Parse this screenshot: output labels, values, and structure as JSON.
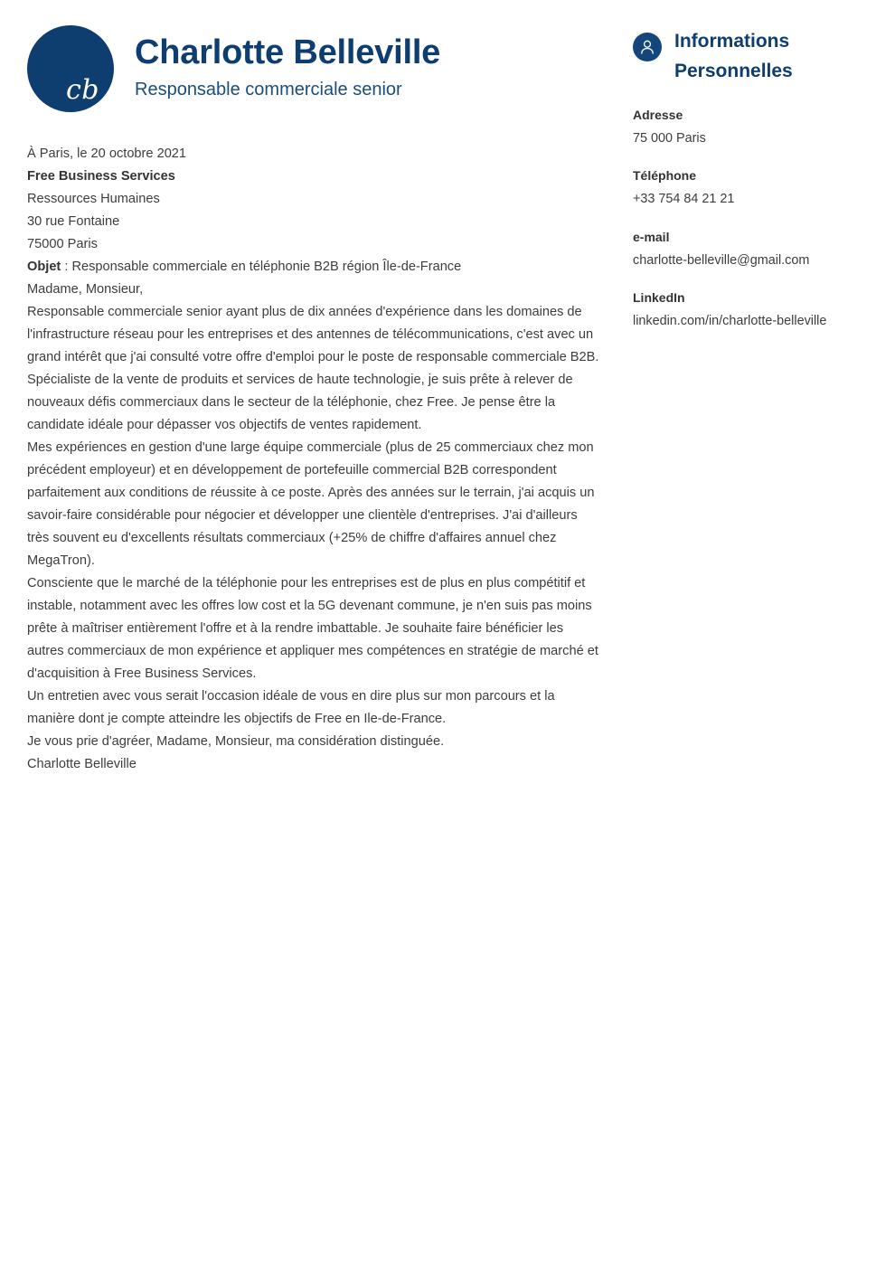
{
  "header": {
    "monogram": "cb",
    "monogram_icon": "monogram-initials",
    "full_name": "Charlotte Belleville",
    "job_title": "Responsable commerciale senior"
  },
  "letter": {
    "date_line": "À Paris, le 20 octobre 2021",
    "recipient": {
      "organization": "Free Business Services",
      "department": "Ressources Humaines",
      "street": "30 rue Fontaine",
      "city": "75000 Paris"
    },
    "subject": {
      "label": "Objet",
      "text": " : Responsable commerciale en téléphonie B2B région Île-de-France"
    },
    "salutation": "Madame, Monsieur,",
    "paragraphs": [
      "Responsable commerciale senior ayant plus de dix années d'expérience dans les domaines de l'infrastructure réseau pour les entreprises et des antennes de télécommunications, c'est avec un grand intérêt que j'ai consulté votre offre d'emploi pour le poste de responsable commerciale B2B. Spécialiste de la vente de produits et services de haute technologie, je suis prête à relever de nouveaux défis commerciaux dans le secteur de la téléphonie, chez Free. Je pense être la candidate idéale pour dépasser vos objectifs de ventes rapidement.",
      "Mes expériences en gestion d'une large équipe commerciale (plus de 25 commerciaux chez mon précédent employeur) et en développement de portefeuille commercial B2B correspondent parfaitement aux conditions de réussite à ce poste. Après des années sur le terrain, j'ai acquis un savoir-faire considérable pour négocier et développer une clientèle d'entreprises. J'ai d'ailleurs très souvent eu d'excellents résultats commerciaux (+25% de chiffre d'affaires annuel chez MegaTron).",
      "Consciente que le marché de la téléphonie pour les entreprises est de plus en plus compétitif et instable, notamment avec les offres low cost et la 5G devenant commune, je n'en suis pas moins prête à maîtriser entièrement l'offre et à la rendre imbattable. Je souhaite faire bénéficier les autres commerciaux de mon expérience et appliquer mes compétences en stratégie de marché et d'acquisition à Free Business Services.",
      "Un entretien avec vous serait l'occasion idéale de vous en dire plus sur mon parcours et la manière dont je compte atteindre les objectifs de Free en Ile-de-France.",
      "Je vous prie d'agréer, Madame, Monsieur, ma considération distinguée."
    ],
    "signature": "Charlotte Belleville"
  },
  "sidebar": {
    "icon": "person-icon",
    "title_line_1": "Informations",
    "title_line_2": "Personnelles",
    "contacts": [
      {
        "label": "Adresse",
        "value": "75 000 Paris"
      },
      {
        "label": "Téléphone",
        "value": "+33 754 84 21 21"
      },
      {
        "label": "e-mail",
        "value": "charlotte-belleville@gmail.com"
      },
      {
        "label": "LinkedIn",
        "value": "linkedin.com/in/charlotte-belleville"
      }
    ]
  },
  "colors": {
    "navy": "#0e3d70",
    "navy_badge": "#14467c",
    "subtitle_navy": "#1a4d7a",
    "body_text": "#3d3d3d",
    "strong_text": "#333333",
    "page_background": "#ffffff"
  }
}
